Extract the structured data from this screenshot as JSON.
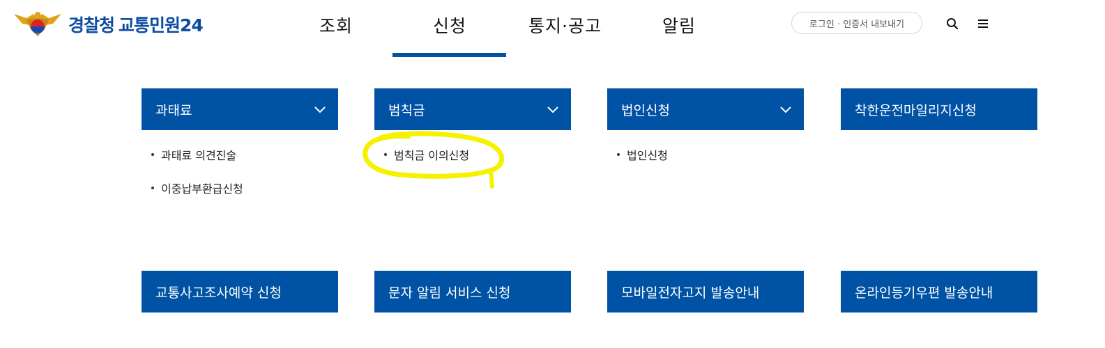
{
  "header": {
    "logo_part1": "경찰청",
    "logo_part2": "교통민원24",
    "nav": [
      "조회",
      "신청",
      "통지·공고",
      "알림"
    ],
    "active_nav": "신청",
    "login_label": "로그인 · 인증서 내보내기",
    "icons": [
      "search-icon",
      "menu-icon"
    ]
  },
  "menu": {
    "row1": [
      {
        "title": "과태료",
        "items": [
          "과태료 의견진술",
          "이중납부환급신청"
        ]
      },
      {
        "title": "범칙금",
        "items": [
          "범칙금 이의신청"
        ]
      },
      {
        "title": "법인신청",
        "items": [
          "법인신청"
        ]
      },
      {
        "title": "착한운전마일리지신청"
      }
    ],
    "row2": [
      {
        "title": "교통사고조사예약 신청"
      },
      {
        "title": "문자 알림 서비스 신청"
      },
      {
        "title": "모바일전자고지 발송안내"
      },
      {
        "title": "온라인등기우편 발송안내"
      }
    ]
  },
  "colors": {
    "brand_blue": "#0052a4",
    "highlight": "#f5f200"
  }
}
